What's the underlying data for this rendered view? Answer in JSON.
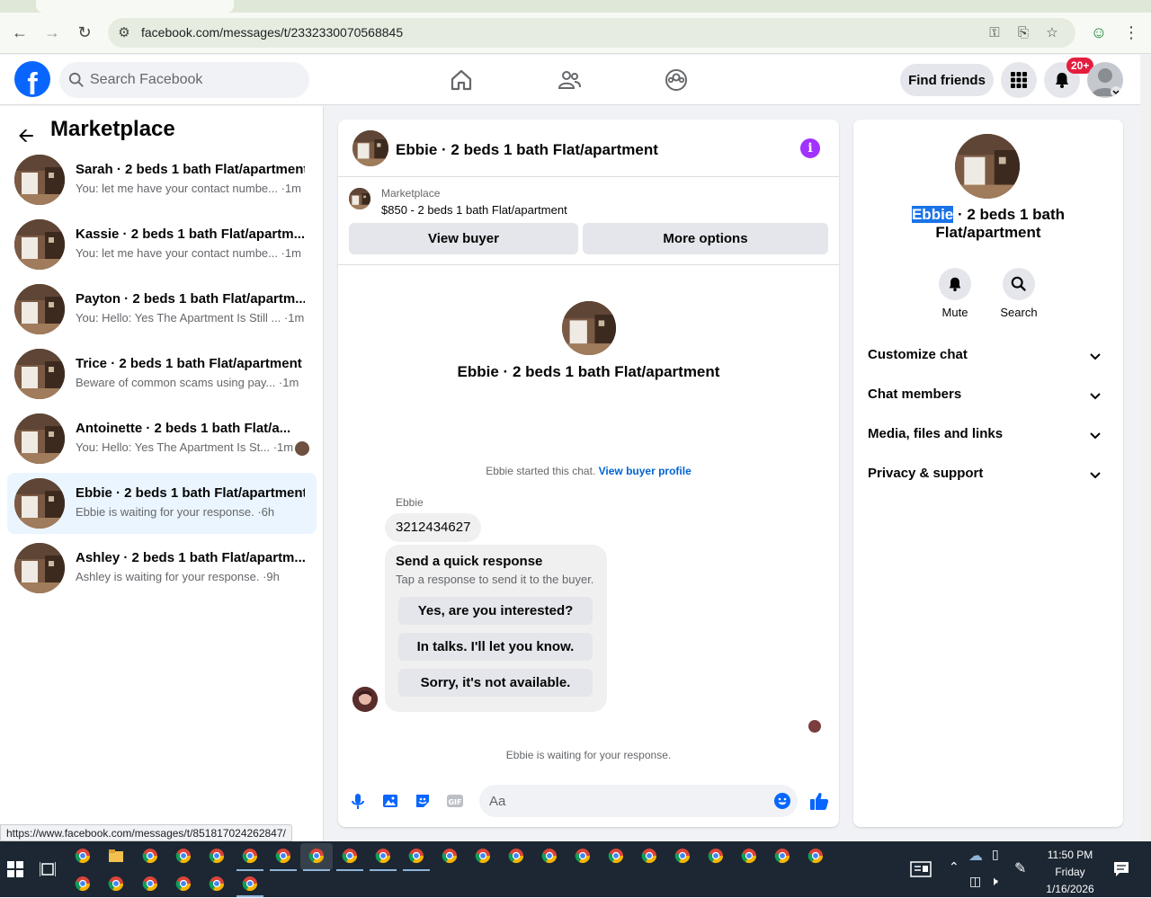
{
  "browser": {
    "url": "facebook.com/messages/t/2332330070568845",
    "status_url": "https://www.facebook.com/messages/t/851817024262847/"
  },
  "header": {
    "search_placeholder": "Search Facebook",
    "find_friends_label": "Find friends",
    "notifications_badge": "20+"
  },
  "sidebar": {
    "title": "Marketplace",
    "conversations": [
      {
        "name": "Sarah · 2 beds 1 bath Flat/apartment",
        "preview": "You: let me have your contact numbe... ·1m",
        "active": false
      },
      {
        "name": "Kassie · 2 beds 1 bath Flat/apartm...",
        "preview": "You: let me have your contact numbe... ·1m",
        "active": false
      },
      {
        "name": "Payton · 2 beds 1 bath Flat/apartm...",
        "preview": "You: Hello: Yes The Apartment Is Still ... ·1m",
        "active": false
      },
      {
        "name": "Trice · 2 beds 1 bath Flat/apartment",
        "preview": "Beware of common scams using pay... ·1m",
        "active": false
      },
      {
        "name": "Antoinette · 2 beds 1 bath Flat/a...",
        "preview": "You: Hello: Yes The Apartment Is St... ·1m",
        "active": false
      },
      {
        "name": "Ebbie · 2 beds 1 bath Flat/apartment",
        "preview": "Ebbie is waiting for your response. ·6h",
        "active": true
      },
      {
        "name": "Ashley · 2 beds 1 bath Flat/apartm...",
        "preview": "Ashley is waiting for your response. ·9h",
        "active": false
      }
    ]
  },
  "chat": {
    "title": "Ebbie · 2 beds 1 bath Flat/apartment",
    "listing_label": "Marketplace",
    "listing_price": "$850 - 2 beds 1 bath Flat/apartment",
    "view_buyer_label": "View buyer",
    "more_options_label": "More options",
    "center_name": "Ebbie · 2 beds 1 bath Flat/apartment",
    "started_text": "Ebbie started this chat.",
    "view_buyer_profile_label": "View buyer profile",
    "sender_label": "Ebbie",
    "phone_message": "3212434627",
    "quick_title": "Send a quick response",
    "quick_subtitle": "Tap a response to send it to the buyer.",
    "quick_responses": [
      "Yes, are you interested?",
      "In talks. I'll let you know.",
      "Sorry, it's not available."
    ],
    "waiting_text": "Ebbie is waiting for your response.",
    "composer_placeholder": "Aa"
  },
  "right_panel": {
    "name_highlight": "Ebbie",
    "name_rest": " · 2 beds 1 bath Flat/apartment",
    "mute_label": "Mute",
    "search_label": "Search",
    "sections": [
      "Customize chat",
      "Chat members",
      "Media, files and links",
      "Privacy & support"
    ]
  },
  "taskbar": {
    "time": "11:50 PM",
    "day": "Friday",
    "date": "1/16/2026"
  },
  "colors": {
    "fb_blue": "#0866ff",
    "active_conv": "#ebf5ff",
    "info_purple": "#a033ff",
    "badge_red": "#e41e3f",
    "link": "#0064d1"
  }
}
